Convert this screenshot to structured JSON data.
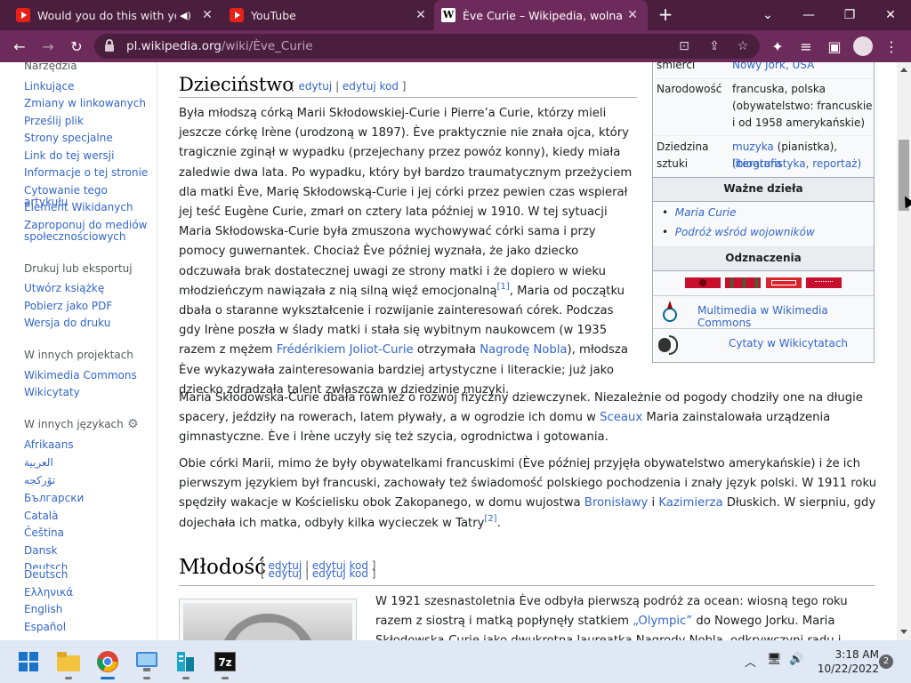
{
  "browser": {
    "tabs": [
      {
        "title": "Would you do this with your",
        "icon": "youtube-icon",
        "muted": true
      },
      {
        "title": "YouTube",
        "icon": "youtube-icon"
      },
      {
        "title": "Ève Curie – Wikipedia, wolna enc",
        "icon": "wikipedia-icon",
        "active": true
      }
    ],
    "url_host": "pl.wikipedia.org",
    "url_path": "/wiki/Ève_Curie",
    "colors": {
      "frame": "#4a1e3d",
      "toolbar": "#6d2b5c",
      "link": "#3366cc"
    }
  },
  "sidebar": {
    "tools_heading": "Narzędzia",
    "tools": [
      "Linkujące",
      "Zmiany w linkowanych",
      "Prześlij plik",
      "Strony specjalne",
      "Link do tej wersji",
      "Informacje o tej stronie",
      "Cytowanie tego artykułu",
      "Element Wikidanych",
      "Zaproponuj do mediów społecznościowych"
    ],
    "print_heading": "Drukuj lub eksportuj",
    "print": [
      "Utwórz książkę",
      "Pobierz jako PDF",
      "Wersja do druku"
    ],
    "projects_heading": "W innych projektach",
    "projects": [
      "Wikimedia Commons",
      "Wikicytaty"
    ],
    "languages_heading": "W innych językach",
    "languages": [
      "Afrikaans",
      "العربية",
      "تۆرکجه",
      "Български",
      "Català",
      "Čeština",
      "Dansk",
      "Deutsch",
      "Deutsch",
      "Ελληνικά",
      "English",
      "Español"
    ]
  },
  "article": {
    "section1_title": "Dzieciństwo",
    "edit_label": "edytuj",
    "edit_code_label": "edytuj kod",
    "section2_title": "Młodość",
    "p1": {
      "a": "Była młodszą córką Marii Skłodowskiej-Curie i Pierre’a Curie, którzy mieli jeszcze córkę Irène (urodzoną w 1897). Ève praktycznie nie znała ojca, który tragicznie zginął w wypadku (przejechany przez powóz konny), kiedy miała zaledwie dwa lata. Po wypadku, który był bardzo traumatycznym przeżyciem dla matki Ève, Marię Skłodowską-Curie i jej córki przez pewien czas wspierał jej teść Eugène Curie, zmarł on cztery lata później w 1910. W tej sytuacji Maria Skłodowska-Curie była zmuszona wychowywać córki sama i przy pomocy guwernantek. Chociaż Ève później wyznała, że jako dziecko odczuwała brak dostatecznej uwagi ze strony matki i że dopiero w wieku młodzieńczym nawiązała z nią silną więź emocjonalną",
      "ref1": "[1]",
      "b": ", Maria od początku dbała o staranne wykształcenie i rozwijanie zainteresowań córek. Podczas gdy Irène poszła w ślady matki i stała się wybitnym naukowcem (w 1935 razem z mężem ",
      "link1": "Frédérikiem Joliot-Curie",
      "c": " otrzymała ",
      "link2": "Nagrodę Nobla",
      "d": "), młodsza Ève wykazywała zainteresowania bardziej artystyczne i literackie; już jako dziecko zdradzała talent zwłaszcza w dziedzinie muzyki."
    },
    "p2": {
      "a": "Maria Skłodowska-Curie dbała również o rozwój fizyczny dziewczynek. Niezależnie od pogody chodziły one na długie spacery, jeździły na rowerach, latem pływały, a w ogrodzie ich domu w ",
      "link1": "Sceaux",
      "b": " Maria zainstalowała urządzenia gimnastyczne. Ève i Irène uczyły się też szycia, ogrodnictwa i gotowania."
    },
    "p3": {
      "a": "Obie córki Marii, mimo że były obywatelkami francuskimi (Ève później przyjęła obywatelstwo amerykańskie) i że ich pierwszym językiem był francuski, zachowały też świadomość polskiego pochodzenia i znały język polski. W 1911 roku spędziły wakacje w Kościelisku obok Zakopanego, w domu wujostwa ",
      "link1": "Bronisławy",
      "b": " i ",
      "link2": "Kazimierza",
      "c": " Dłuskich. W sierpniu, gdy dojechała ich matka, odbyły kilka wycieczek w Tatry",
      "ref2": "[2]",
      "d": "."
    },
    "p4": {
      "a": "W 1921 szesnastoletnia Ève odbyła pierwszą podróż za ocean: wiosną tego roku razem z siostrą i matką popłynęły statkiem ",
      "link1": "„Olympic”",
      "b": " do Nowego Jorku. Maria Skłodowska-Curie jako dwukrotna laureatka Nagrody Nobla, odkrywczyni radu i polonu, była tam"
    }
  },
  "infobox": {
    "death_place_label": "śmierci",
    "death_place": "Nowy Jork, USA",
    "nationality_label": "Narodowość",
    "nationality": "francuska, polska (obywatelstwo: francuskie i od 1958 amerykańskie)",
    "nationality_l1": "francuska, polska",
    "nationality_l2": "(obywatelstwo: francuskie",
    "nationality_l3": "i od 1958 amerykańskie)",
    "field_label_1": "Dziedzina",
    "field_label_2": "sztuki",
    "field_music": "muzyka",
    "field_music_note": " (pianistka), ",
    "field_lit": "literatura",
    "field_bio_open": "(",
    "field_bio": "biografistyka",
    "field_sep": ", ",
    "field_rep": "reportaż",
    "field_close": ")",
    "works_heading": "Ważne dzieła",
    "works": [
      "Maria Curie",
      "Podróż wśród wojowników"
    ],
    "awards_heading": "Odznaczenia",
    "commons_link": "Multimedia w Wikimedia Commons",
    "quotes_link": "Cytaty w Wikicytatach"
  },
  "taskbar": {
    "apps": [
      "start-icon",
      "file-explorer-icon",
      "chrome-icon",
      "control-panel-icon",
      "network-icon",
      "7zip-icon"
    ],
    "app_label_7zip": "7z",
    "time": "3:18 AM",
    "date": "10/22/2022",
    "notifications": "2"
  }
}
